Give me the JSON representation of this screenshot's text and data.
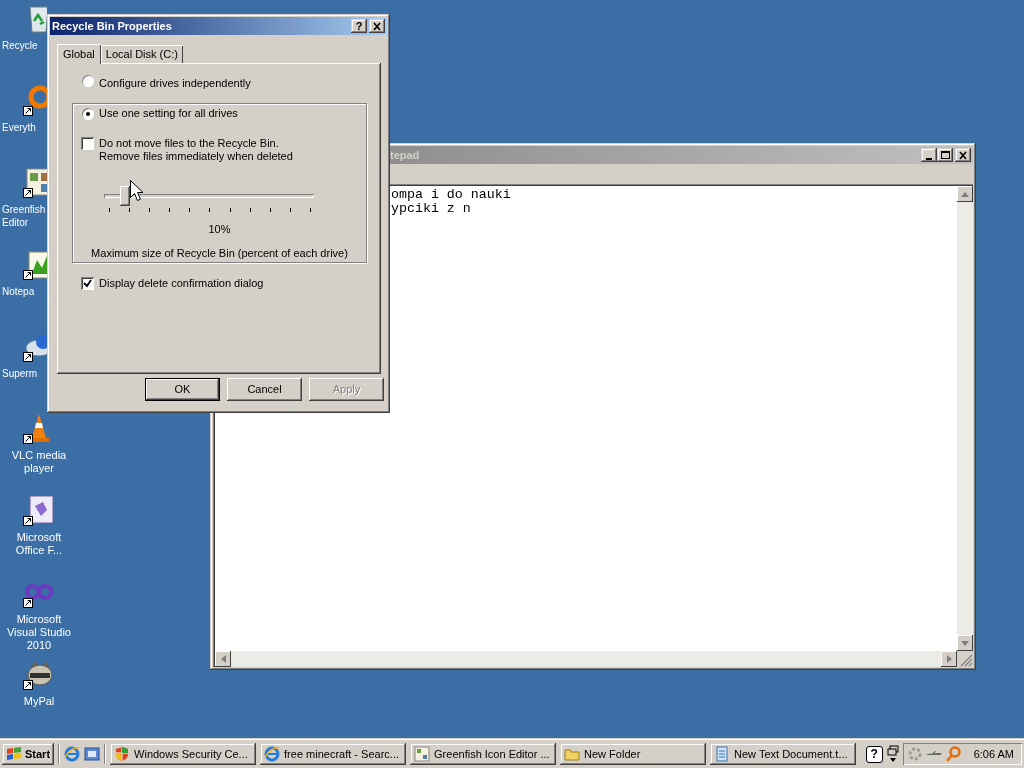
{
  "desktop_icons": [
    {
      "label": "Recycle"
    },
    {
      "label": "Everyth"
    },
    {
      "label": "Greenfish Editor"
    },
    {
      "label": "Notepa"
    },
    {
      "label": "Superm"
    },
    {
      "label": "VLC media player"
    },
    {
      "label": "Microsoft Office F..."
    },
    {
      "label": "Microsoft Visual Studio 2010"
    },
    {
      "label": "MyPal"
    }
  ],
  "notepad": {
    "title": "tepad",
    "lines": [
      "ompa i do nauki",
      "ypciki z n"
    ]
  },
  "dialog": {
    "title": "Recycle Bin Properties",
    "help": "?",
    "tabs": [
      {
        "label": "Global",
        "selected": true
      },
      {
        "label": "Local Disk (C:)",
        "selected": false
      }
    ],
    "options": [
      {
        "label": "Configure drives independently",
        "selected": false
      },
      {
        "label": "Use one setting for all drives",
        "selected": true
      }
    ],
    "no_recycle": {
      "label": "Do not move files to the Recycle Bin.\nRemove files immediately when deleted",
      "checked": false
    },
    "slider": {
      "level": 0.1
    },
    "slider_reading": "10%",
    "slider_caption": "Maximum size of Recycle Bin (percent of each drive)",
    "confirm": {
      "label": "Display delete confirmation dialog",
      "checked": true
    },
    "buttons": [
      {
        "label": "OK",
        "default": true,
        "disabled": false
      },
      {
        "label": "Cancel",
        "default": false,
        "disabled": false
      },
      {
        "label": "Apply",
        "default": false,
        "disabled": true
      }
    ]
  },
  "taskbar": {
    "start": "Start",
    "tasks": [
      {
        "label": "Windows Security Ce..."
      },
      {
        "label": "free minecraft - Searc..."
      },
      {
        "label": "Greenfish Icon Editor ..."
      },
      {
        "label": "New Folder"
      },
      {
        "label": "New Text Document.t..."
      }
    ],
    "help": "?",
    "clock": "6:06 AM"
  }
}
